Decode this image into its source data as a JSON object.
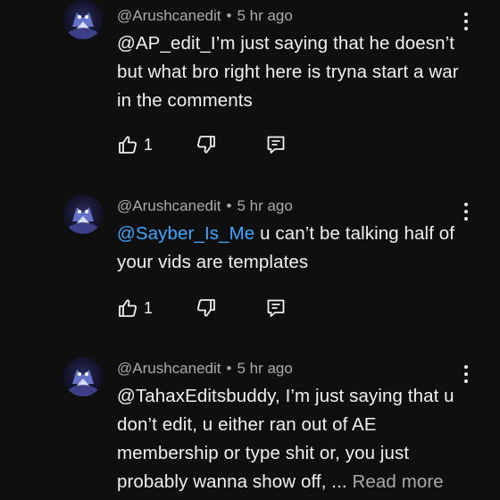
{
  "comments": [
    {
      "author": "@Arushcanedit",
      "separator": "•",
      "time": "5 hr ago",
      "mention": "",
      "text": "@AP_edit_I’m just saying that he doesn’t but what bro right here is tryna start a war in the comments",
      "read_more": "",
      "like_count": "1",
      "icons": {
        "like": "thumbs-up-icon",
        "dislike": "thumbs-down-icon",
        "reply": "reply-icon",
        "menu": "more-vert-icon"
      }
    },
    {
      "author": "@Arushcanedit",
      "separator": "•",
      "time": "5 hr ago",
      "mention": " @Sayber_Is_Me",
      "text": " u can’t be talking half of your vids are templates",
      "read_more": "",
      "like_count": "1",
      "icons": {
        "like": "thumbs-up-icon",
        "dislike": "thumbs-down-icon",
        "reply": "reply-icon",
        "menu": "more-vert-icon"
      }
    },
    {
      "author": "@Arushcanedit",
      "separator": "•",
      "time": "5 hr ago",
      "mention": "",
      "text": "@TahaxEditsbuddy, I’m just saying that u don’t edit, u either ran out of AE membership or type shit or, you just probably wanna show off, ...",
      "read_more": " Read more",
      "like_count": "",
      "icons": {
        "menu": "more-vert-icon"
      }
    }
  ],
  "colors": {
    "background": "#0f0f0f",
    "text": "#f1f1f1",
    "secondary": "#aaaaaa",
    "mention": "#3ea6ff"
  }
}
